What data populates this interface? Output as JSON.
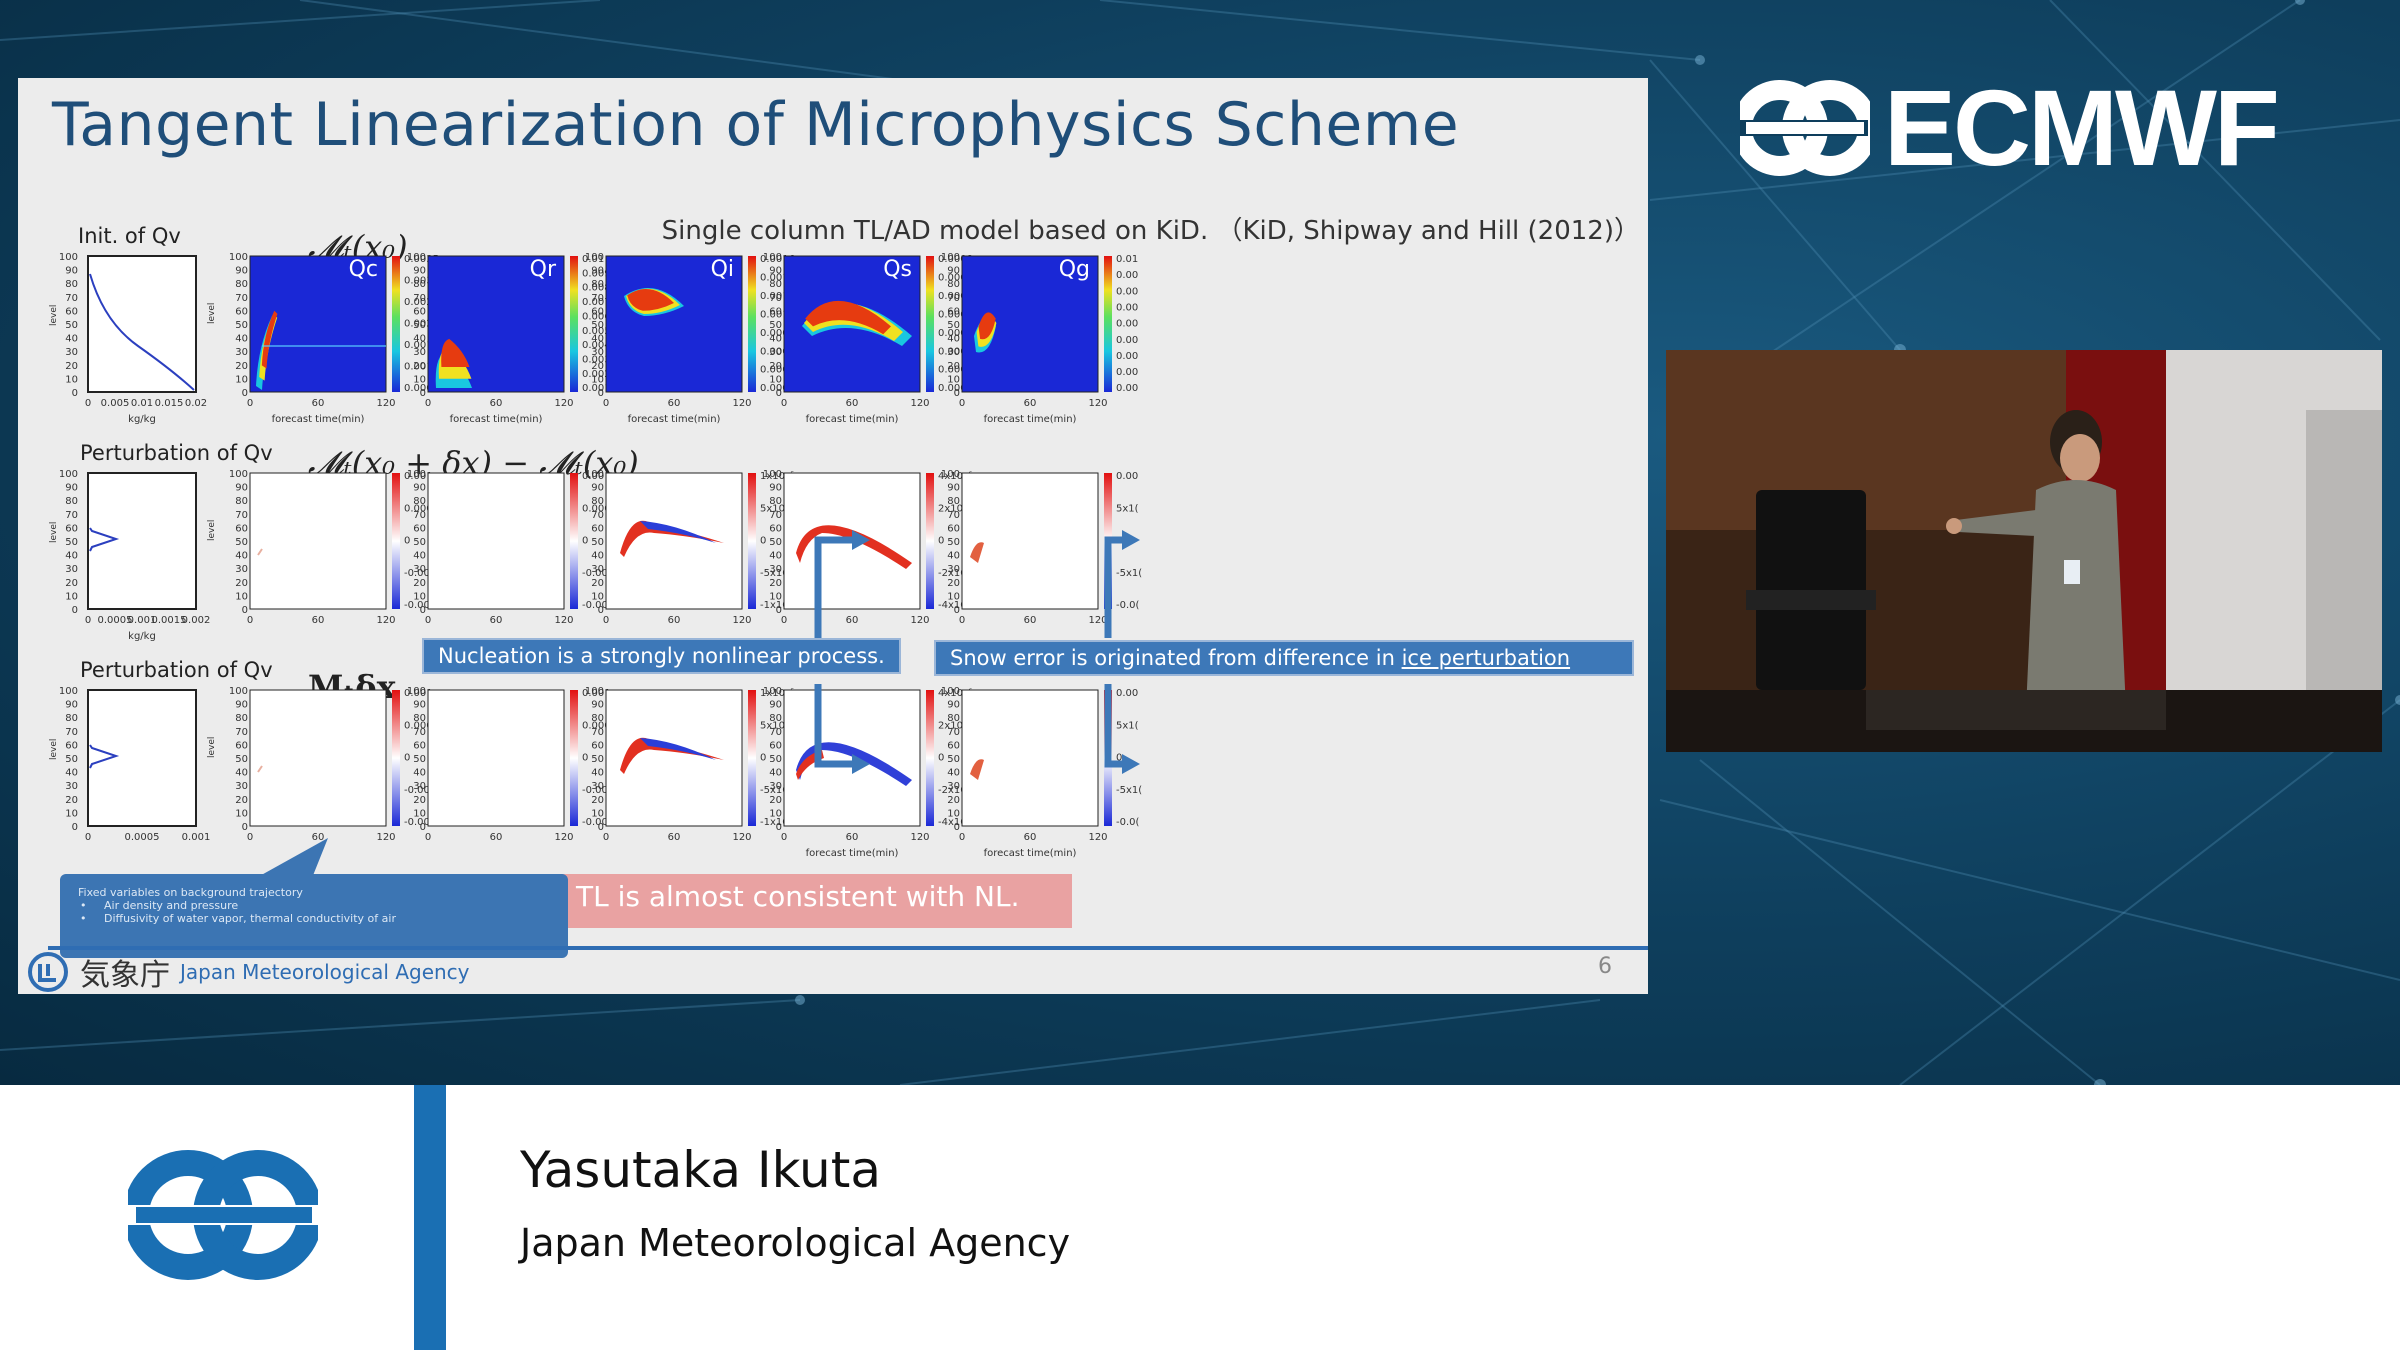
{
  "brand": {
    "name": "ECMWF"
  },
  "slide": {
    "title": "Tangent Linearization of Microphysics Scheme",
    "subtitle": "Single column TL/AD model based on KiD. （KiD, Shipway and Hill (2012)）",
    "row_labels": {
      "nl": "𝓜ₜ(x₀)",
      "diff": "𝓜ₜ(x₀ + δx) − 𝓜ₜ(x₀)",
      "tl": "Mₜδx"
    },
    "left_plots": [
      {
        "title": "Init. of Qv",
        "ylabel": "level",
        "xlabel": "kg/kg",
        "xticks": [
          "0",
          "0.005",
          "0.01",
          "0.015",
          "0.02"
        ]
      },
      {
        "title": "Perturbation of Qv",
        "ylabel": "level",
        "xlabel": "kg/kg",
        "xticks": [
          "0",
          "0.0005",
          "0.001",
          "0.0015",
          "0.002"
        ]
      },
      {
        "title": "Perturbation of Qv",
        "ylabel": "level",
        "xlabel": "",
        "xticks": [
          "0",
          "0.0005",
          "0.001"
        ]
      }
    ],
    "yticks": [
      "100",
      "90",
      "80",
      "70",
      "60",
      "50",
      "40",
      "30",
      "20",
      "10",
      "0"
    ],
    "xticks_time": [
      "0",
      "60",
      "120"
    ],
    "xlabel_time": "forecast time(min)",
    "species": [
      "Qc",
      "Qr",
      "Qi",
      "Qs",
      "Qg"
    ],
    "colorbars_row1": [
      [
        "0.0035",
        "0.003",
        "0.0025",
        "0.002",
        "0.0015",
        "0.001",
        "0.0005"
      ],
      [
        "0.01",
        "0.009",
        "0.008",
        "0.007",
        "0.006",
        "0.005",
        "0.004",
        "0.003",
        "0.002",
        "0.001"
      ],
      [
        "0.0016",
        "0.0014",
        "0.0012",
        "0.001",
        "0.0008",
        "0.0006",
        "0.0004",
        "0.0002"
      ],
      [
        "0.0008",
        "0.0007",
        "0.0006",
        "0.0005",
        "0.0004",
        "0.0003",
        "0.0002",
        "0.0001"
      ],
      [
        "0.01",
        "0.00",
        "0.00",
        "0.00",
        "0.00",
        "0.00",
        "0.00",
        "0.00",
        "0.00"
      ]
    ],
    "colorbars_row2": [
      [
        "0.001",
        "0.0005",
        "0",
        "-0.0005",
        "-0.001"
      ],
      [
        "0.001",
        "0.0005",
        "0",
        "-0.0005",
        "-0.001"
      ],
      [
        "1x10⁻⁵",
        "5x10⁻⁶",
        "0",
        "-5x10⁻⁶",
        "-1x10⁻⁵"
      ],
      [
        "4x10⁻⁶",
        "2x10⁻⁶",
        "0",
        "-2x10⁻⁶",
        "-4x10⁻⁶"
      ],
      [
        "0.00",
        "5x1(",
        "0",
        "-5x1(",
        "-0.0("
      ]
    ],
    "colorbars_row3": [
      [
        "0.001",
        "0.0005",
        "0",
        "-0.0005",
        "-0.001"
      ],
      [
        "0.001",
        "0.0005",
        "0",
        "-0.0005",
        "-0.001"
      ],
      [
        "1x10⁻⁵",
        "5x10⁻⁶",
        "0",
        "-5x10⁻⁶",
        "-1x10⁻⁵"
      ],
      [
        "4x10⁻⁶",
        "2x10⁻⁶",
        "0",
        "-2x10⁻⁶",
        "-4x10⁻⁶"
      ],
      [
        "0.00",
        "5x1(",
        "0",
        "-5x1(",
        "-0.0("
      ]
    ],
    "callout_nucleation": "Nucleation is a strongly nonlinear process.",
    "callout_snow_prefix": "Snow error is originated from difference in ",
    "callout_snow_link": "ice perturbation",
    "tl_consistent": "TL is almost consistent with NL.",
    "note": {
      "heading": "Fixed variables on background trajectory",
      "items": [
        "Air density and pressure",
        "Diffusivity of water vapor, thermal conductivity of air"
      ]
    },
    "footer": {
      "org_kanji": "気象庁",
      "org_name": "Japan Meteorological Agency",
      "page": "6"
    }
  },
  "lower_third": {
    "speaker": "Yasutaka Ikuta",
    "affiliation": "Japan Meteorological Agency"
  },
  "colors": {
    "title": "#1f4e79",
    "accent": "#1a6fb3",
    "callout": "#3d78b8",
    "tl_box": "#e9a2a2"
  }
}
